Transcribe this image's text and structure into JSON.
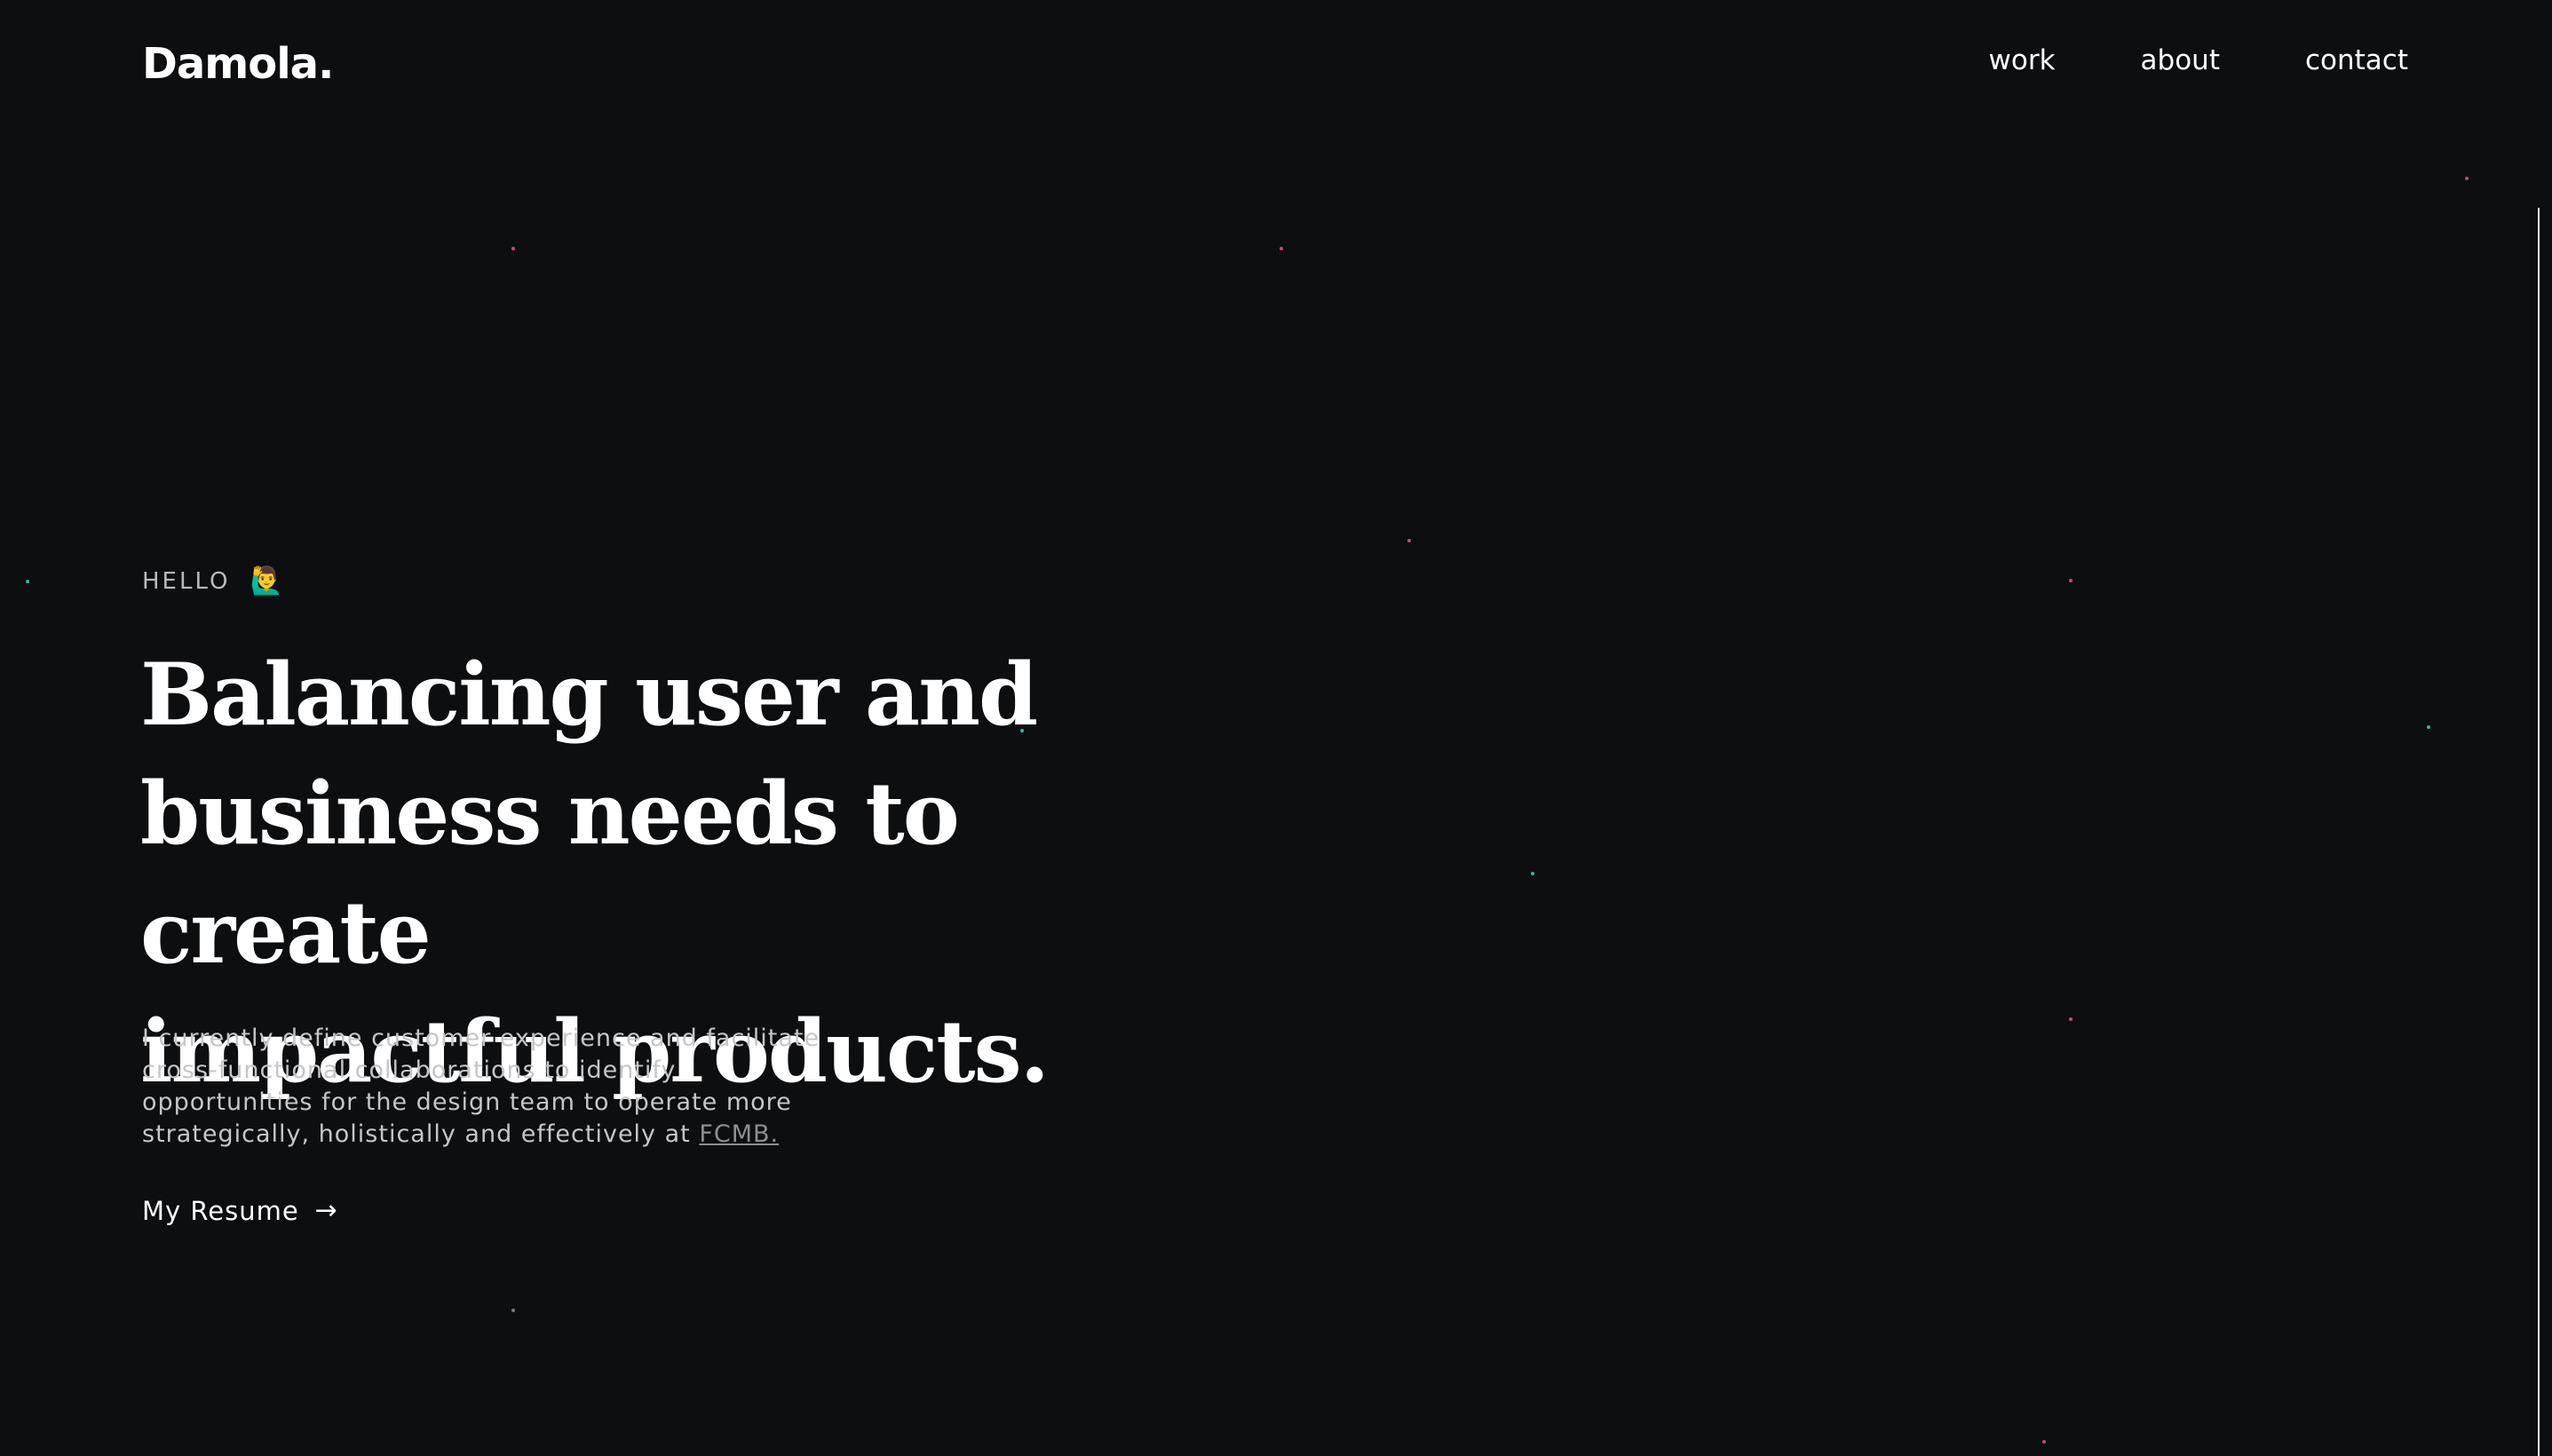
{
  "header": {
    "logo": "Damola.",
    "nav": [
      "work",
      "about",
      "contact"
    ]
  },
  "hero": {
    "eyebrow": "HELLO",
    "eyebrow_emoji": "🙋‍♂️",
    "headline_lines": [
      "Balancing user and",
      "business needs to create",
      "impactful products."
    ],
    "intro_prefix": "I currently define customer experience and facilitate cross-functional collaborations to identify opportunities for the design team to operate more strategically, holistically and effectively at",
    "intro_link": "FCMB.",
    "resume_label": "My Resume",
    "resume_arrow": "→"
  },
  "colors": {
    "background": "#0d0e10",
    "star_pink": "#c94a6a",
    "star_teal": "#2fb8a4"
  }
}
